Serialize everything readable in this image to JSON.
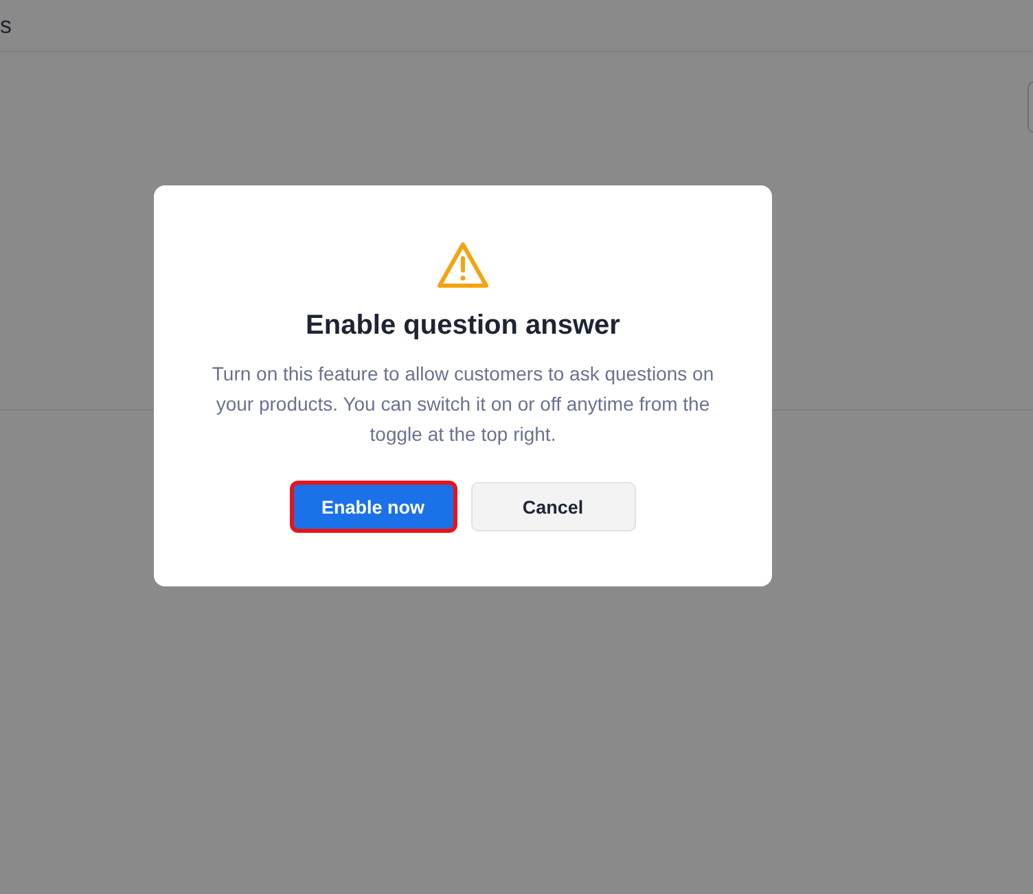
{
  "page": {
    "header_text": "s"
  },
  "dialog": {
    "title": "Enable question answer",
    "message": "Turn on this feature to allow customers to ask questions on your products. You can switch it on or off anytime from the toggle at the top right.",
    "buttons": [
      {
        "label": "Enable now",
        "kind": "primary",
        "highlighted": true
      },
      {
        "label": "Cancel",
        "kind": "secondary",
        "highlighted": false
      }
    ]
  }
}
